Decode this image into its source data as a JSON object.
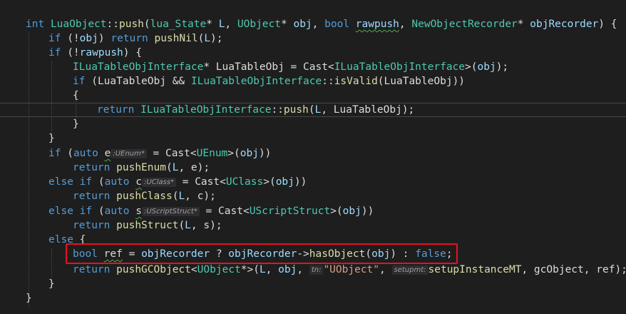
{
  "code": {
    "l1": {
      "kw_int": "int",
      "cls": "LuaObject",
      "sep": "::",
      "fn": "push",
      "rest1": "(",
      "t_lua": "lua_State",
      "rest2": "* ",
      "p_L": "L",
      "rest3": ", ",
      "t_uobj": "UObject",
      "rest4": "* ",
      "p_obj": "obj",
      "rest5": ", ",
      "kw_bool": "bool",
      "rest6": " ",
      "p_raw": "rawpush",
      "rest7": ", ",
      "t_rec": "NewObjectRecorder",
      "rest8": "* ",
      "p_rec": "objRecorder",
      "rest9": ") {"
    },
    "l2": {
      "kw_if": "if",
      "t1": " (!",
      "p": "obj",
      "t2": ") ",
      "kw_ret": "return",
      "t3": " ",
      "fn": "pushNil",
      "t4": "(",
      "pL": "L",
      "t5": ");"
    },
    "l3": {
      "kw_if": "if",
      "t1": " (!",
      "p": "rawpush",
      "t2": ") {"
    },
    "l4": {
      "ty": "ILuaTableObjInterface",
      "t1": "* ",
      "var": "LuaTableObj",
      "t2": " = ",
      "fn": "Cast",
      "t3": "<",
      "ty2": "ILuaTableObjInterface",
      "t4": ">(",
      "p": "obj",
      "t5": ");"
    },
    "l5": {
      "kw_if": "if",
      "t1": " (",
      "var": "LuaTableObj",
      "t2": " && ",
      "ty": "ILuaTableObjInterface",
      "t3": "::",
      "fn": "isValid",
      "t4": "(",
      "var2": "LuaTableObj",
      "t5": "))"
    },
    "l6": {
      "t": "{"
    },
    "l7": {
      "kw_ret": "return",
      "t1": " ",
      "ty": "ILuaTableObjInterface",
      "t2": "::",
      "fn": "push",
      "t3": "(",
      "pL": "L",
      "t4": ", ",
      "var": "LuaTableObj",
      "t5": ");"
    },
    "l8": {
      "t": "}"
    },
    "l9": {
      "t": "}"
    },
    "l10": {
      "kw_if": "if",
      "t1": " (",
      "kw_auto": "auto",
      "t2": " ",
      "var": "e",
      "hint": ":UEnum*",
      "t3": " = ",
      "fn": "Cast",
      "t4": "<",
      "ty": "UEnum",
      "t5": ">(",
      "p": "obj",
      "t6": "))"
    },
    "l11": {
      "kw_ret": "return",
      "t1": " ",
      "fn": "pushEnum",
      "t2": "(",
      "pL": "L",
      "t3": ", ",
      "var": "e",
      "t4": ");"
    },
    "l12": {
      "kw_else": "else",
      "t0": " ",
      "kw_if": "if",
      "t1": " (",
      "kw_auto": "auto",
      "t2": " ",
      "var": "c",
      "hint": ":UClass*",
      "t3": " = ",
      "fn": "Cast",
      "t4": "<",
      "ty": "UClass",
      "t5": ">(",
      "p": "obj",
      "t6": "))"
    },
    "l13": {
      "kw_ret": "return",
      "t1": " ",
      "fn": "pushClass",
      "t2": "(",
      "pL": "L",
      "t3": ", ",
      "var": "c",
      "t4": ");"
    },
    "l14": {
      "kw_else": "else",
      "t0": " ",
      "kw_if": "if",
      "t1": " (",
      "kw_auto": "auto",
      "t2": " ",
      "var": "s",
      "hint": ":UScriptStruct*",
      "t3": " = ",
      "fn": "Cast",
      "t4": "<",
      "ty": "UScriptStruct",
      "t5": ">(",
      "p": "obj",
      "t6": "))"
    },
    "l15": {
      "kw_ret": "return",
      "t1": " ",
      "fn": "pushStruct",
      "t2": "(",
      "pL": "L",
      "t3": ", ",
      "var": "s",
      "t4": ");"
    },
    "l16": {
      "kw_else": "else",
      "t1": " {"
    },
    "l17": {
      "kw_bool": "bool",
      "t1": " ",
      "var": "ref",
      "t2": " = ",
      "p": "objRecorder",
      "t3": " ? ",
      "p2": "objRecorder",
      "t4": "->",
      "fn": "hasObject",
      "t5": "(",
      "p3": "obj",
      "t6": ") : ",
      "kw_false": "false",
      "t7": ";"
    },
    "l18": {
      "kw_ret": "return",
      "t1": " ",
      "fn": "pushGCObject",
      "t2": "<",
      "ty": "UObject",
      "t3": "*>(",
      "pL": "L",
      "t4": ", ",
      "p": "obj",
      "t5": ", ",
      "hint1": "tn:",
      "str": "\"UObject\"",
      "t6": ", ",
      "hint2": "setupmt:",
      "fn2": "setupInstanceMT",
      "t7": ", ",
      "var": "gcObject",
      "t8": ", ",
      "var2": "ref",
      "t9": ");"
    },
    "l19": {
      "t": "}"
    },
    "l20": {
      "t": "}"
    }
  }
}
